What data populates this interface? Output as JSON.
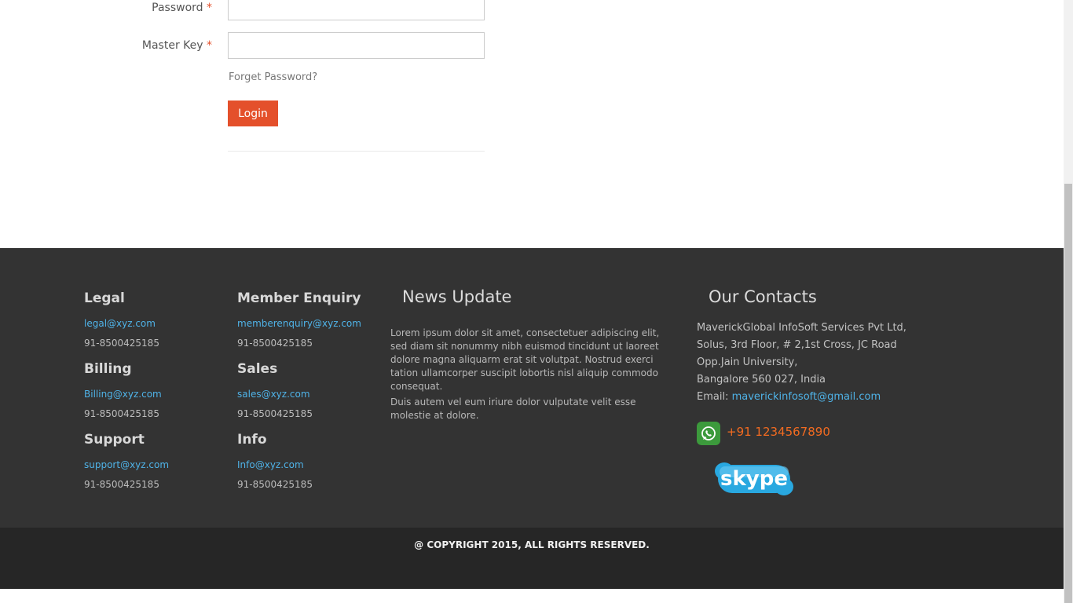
{
  "login_form": {
    "password_label": "Password",
    "master_key_label": "Master Key",
    "required_mark": "*",
    "password_value": "",
    "master_key_value": "",
    "forget_password": "Forget Password?",
    "login_button": "Login"
  },
  "footer": {
    "contacts_columns": [
      {
        "title": "Legal",
        "email": "legal@xyz.com",
        "phone": "91-8500425185"
      },
      {
        "title": "Billing",
        "email": "Billing@xyz.com",
        "phone": "91-8500425185"
      },
      {
        "title": "Support",
        "email": "support@xyz.com",
        "phone": "91-8500425185"
      },
      {
        "title": "Member Enquiry",
        "email": "memberenquiry@xyz.com",
        "phone": "91-8500425185"
      },
      {
        "title": "Sales",
        "email": "sales@xyz.com",
        "phone": "91-8500425185"
      },
      {
        "title": "Info",
        "email": "Info@xyz.com",
        "phone": "91-8500425185"
      }
    ],
    "news_title": "News Update",
    "news_paragraph_1": "Lorem ipsum dolor sit amet, consectetuer adipiscing elit, sed diam sit nonummy nibh euismod tincidunt ut laoreet dolore magna aliquarm erat sit volutpat. Nostrud exerci tation ullamcorper suscipit lobortis nisl aliquip commodo consequat.",
    "news_paragraph_2": "Duis autem vel eum iriure dolor vulputate velit esse molestie at dolore.",
    "contacts_title": "Our Contacts",
    "address_lines": [
      "MaverickGlobal InfoSoft Services Pvt Ltd,",
      "Solus, 3rd Floor, # 2,1st Cross, JC Road",
      "Opp.Jain University,",
      "Bangalore 560 027, India"
    ],
    "email_label": "Email:",
    "email": "maverickinfosoft@gmail.com",
    "whatsapp_phone": "+91 1234567890",
    "skype_text": "skype",
    "copyright": "@ COPYRIGHT 2015, ALL RIGHTS RESERVED."
  },
  "colors": {
    "accent": "#e4502b",
    "link": "#4fb3e8",
    "footer_bg": "#333333",
    "copyright_bg": "#262626",
    "whatsapp_phone": "#f26b21"
  },
  "icons": [
    "whatsapp-icon",
    "skype-logo"
  ]
}
